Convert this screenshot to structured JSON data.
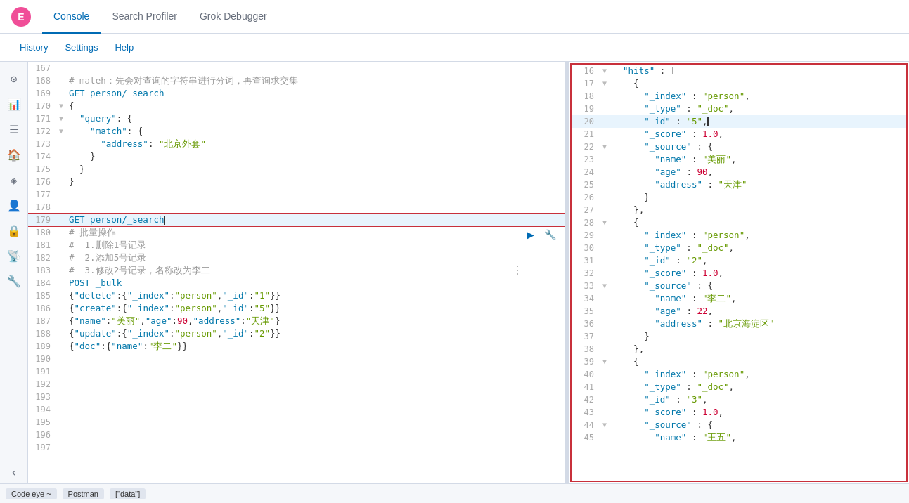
{
  "topNav": {
    "tabs": [
      {
        "label": "Console",
        "active": true
      },
      {
        "label": "Search Profiler",
        "active": false
      },
      {
        "label": "Grok Debugger",
        "active": false
      }
    ]
  },
  "subNav": {
    "items": [
      "History",
      "Settings",
      "Help"
    ]
  },
  "leftEditor": {
    "lines": [
      {
        "num": "167",
        "fold": "",
        "content": ""
      },
      {
        "num": "168",
        "fold": "",
        "content": "# mateh：先会对查询的字符串进行分词，再查询求交集",
        "type": "comment"
      },
      {
        "num": "169",
        "fold": "",
        "content": "GET person/_search",
        "type": "url"
      },
      {
        "num": "170",
        "fold": "▼",
        "content": "{",
        "type": "bracket"
      },
      {
        "num": "171",
        "fold": "▼",
        "content": "  \"query\": {",
        "type": "key"
      },
      {
        "num": "172",
        "fold": "▼",
        "content": "    \"match\": {",
        "type": "key"
      },
      {
        "num": "173",
        "fold": "",
        "content": "      \"address\": \"北京外套\"",
        "type": "kv"
      },
      {
        "num": "174",
        "fold": "",
        "content": "    }",
        "type": "bracket"
      },
      {
        "num": "175",
        "fold": "",
        "content": "  }",
        "type": "bracket"
      },
      {
        "num": "176",
        "fold": "",
        "content": "}",
        "type": "bracket"
      },
      {
        "num": "177",
        "fold": "",
        "content": ""
      },
      {
        "num": "178",
        "fold": "",
        "content": ""
      },
      {
        "num": "179",
        "fold": "",
        "content": "GET person/_search",
        "type": "url",
        "active": true
      },
      {
        "num": "180",
        "fold": "",
        "content": "# 批量操作",
        "type": "comment"
      },
      {
        "num": "181",
        "fold": "",
        "content": "#  1.删除1号记录",
        "type": "comment"
      },
      {
        "num": "182",
        "fold": "",
        "content": "#  2.添加5号记录",
        "type": "comment"
      },
      {
        "num": "183",
        "fold": "",
        "content": "#  3.修改2号记录，名称改为李二",
        "type": "comment"
      },
      {
        "num": "184",
        "fold": "",
        "content": "POST _bulk",
        "type": "url"
      },
      {
        "num": "185",
        "fold": "",
        "content": "{\"delete\":{\"_index\":\"person\",\"_id\":\"1\"}}",
        "type": "json"
      },
      {
        "num": "186",
        "fold": "",
        "content": "{\"create\":{\"_index\":\"person\",\"_id\":\"5\"}}",
        "type": "json"
      },
      {
        "num": "187",
        "fold": "",
        "content": "{\"name\":\"美丽\",\"age\":90,\"address\":\"天津\"}",
        "type": "json"
      },
      {
        "num": "188",
        "fold": "",
        "content": "{\"update\":{\"_index\":\"person\",\"_id\":\"2\"}}",
        "type": "json"
      },
      {
        "num": "189",
        "fold": "",
        "content": "{\"doc\":{\"name\":\"李二\"}}",
        "type": "json"
      },
      {
        "num": "190",
        "fold": "",
        "content": ""
      },
      {
        "num": "191",
        "fold": "",
        "content": ""
      },
      {
        "num": "192",
        "fold": "",
        "content": ""
      },
      {
        "num": "193",
        "fold": "",
        "content": ""
      },
      {
        "num": "194",
        "fold": "",
        "content": ""
      },
      {
        "num": "195",
        "fold": "",
        "content": ""
      },
      {
        "num": "196",
        "fold": "",
        "content": ""
      },
      {
        "num": "197",
        "fold": "",
        "content": ""
      }
    ]
  },
  "rightPanel": {
    "lines": [
      {
        "num": "16",
        "fold": "▼",
        "content": "  \"hits\" : ["
      },
      {
        "num": "17",
        "fold": "▼",
        "content": "    {"
      },
      {
        "num": "18",
        "fold": "",
        "content": "      \"_index\" : \"person\","
      },
      {
        "num": "19",
        "fold": "",
        "content": "      \"_type\" : \"_doc\","
      },
      {
        "num": "20",
        "fold": "",
        "content": "      \"_id\" : \"5\",",
        "highlighted": true
      },
      {
        "num": "21",
        "fold": "",
        "content": "      \"_score\" : 1.0,"
      },
      {
        "num": "22",
        "fold": "▼",
        "content": "      \"_source\" : {"
      },
      {
        "num": "23",
        "fold": "",
        "content": "        \"name\" : \"美丽\","
      },
      {
        "num": "24",
        "fold": "",
        "content": "        \"age\" : 90,"
      },
      {
        "num": "25",
        "fold": "",
        "content": "        \"address\" : \"天津\""
      },
      {
        "num": "26",
        "fold": "",
        "content": "      }"
      },
      {
        "num": "27",
        "fold": "",
        "content": "    },"
      },
      {
        "num": "28",
        "fold": "▼",
        "content": "    {"
      },
      {
        "num": "29",
        "fold": "",
        "content": "      \"_index\" : \"person\","
      },
      {
        "num": "30",
        "fold": "",
        "content": "      \"_type\" : \"_doc\","
      },
      {
        "num": "31",
        "fold": "",
        "content": "      \"_id\" : \"2\","
      },
      {
        "num": "32",
        "fold": "",
        "content": "      \"_score\" : 1.0,"
      },
      {
        "num": "33",
        "fold": "▼",
        "content": "      \"_source\" : {"
      },
      {
        "num": "34",
        "fold": "",
        "content": "        \"name\" : \"李二\","
      },
      {
        "num": "35",
        "fold": "",
        "content": "        \"age\" : 22,"
      },
      {
        "num": "36",
        "fold": "",
        "content": "        \"address\" : \"北京海淀区\""
      },
      {
        "num": "37",
        "fold": "",
        "content": "      }"
      },
      {
        "num": "38",
        "fold": "",
        "content": "    },"
      },
      {
        "num": "39",
        "fold": "▼",
        "content": "    {"
      },
      {
        "num": "40",
        "fold": "",
        "content": "      \"_index\" : \"person\","
      },
      {
        "num": "41",
        "fold": "",
        "content": "      \"_type\" : \"_doc\","
      },
      {
        "num": "42",
        "fold": "",
        "content": "      \"_id\" : \"3\","
      },
      {
        "num": "43",
        "fold": "",
        "content": "      \"_score\" : 1.0,"
      },
      {
        "num": "44",
        "fold": "▼",
        "content": "      \"_source\" : {"
      },
      {
        "num": "45",
        "fold": "",
        "content": "        \"name\" : \"王五\","
      }
    ]
  },
  "taskbar": {
    "items": [
      "Code eye ~",
      "Postman",
      "[\"data\"]"
    ]
  },
  "icons": {
    "logo": "E",
    "run": "▶",
    "wrench": "🔧"
  }
}
